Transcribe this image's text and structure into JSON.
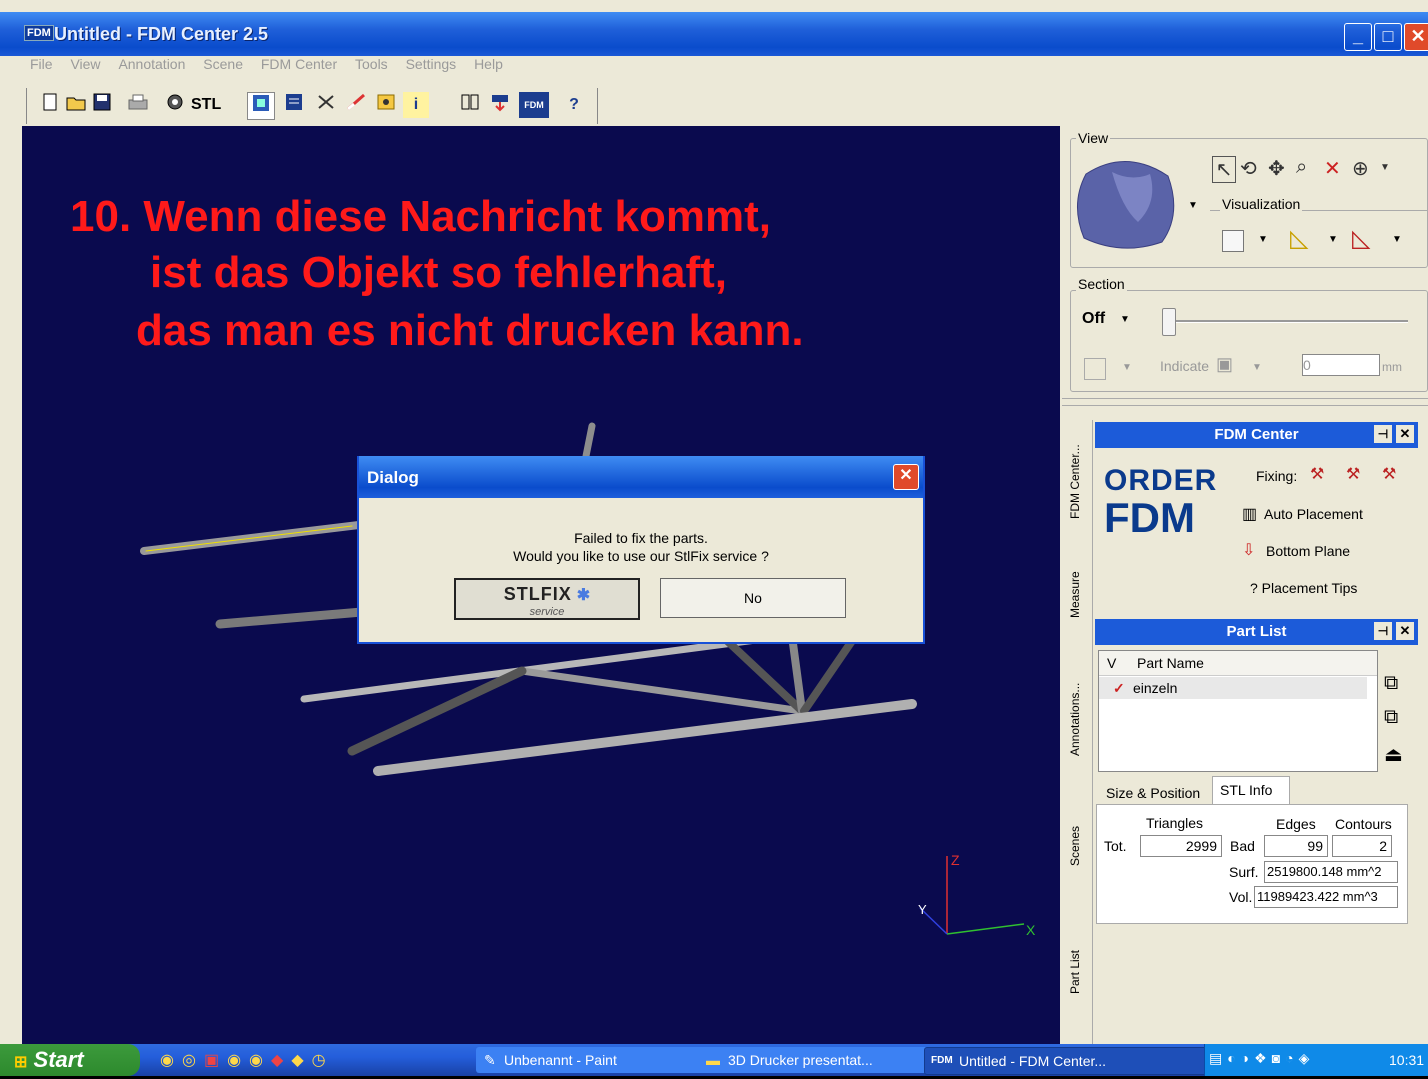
{
  "window": {
    "app_icon": "FDM",
    "title": "Untitled - FDM Center 2.5",
    "controls": [
      "_",
      "□",
      "✕"
    ]
  },
  "menu": [
    "File",
    "View",
    "Annotation",
    "Scene",
    "FDM Center",
    "Tools",
    "Settings",
    "Help"
  ],
  "toolbar": {
    "stl_label": "STL",
    "info_label": "i",
    "fdm_label": "FDM",
    "help_label": "?"
  },
  "viewport": {
    "headline": [
      "10. Wenn diese Nachricht kommt,",
      "ist das Objekt so fehlerhaft,",
      "das man es nicht drucken kann."
    ],
    "axes": {
      "z": "Z",
      "x": "X",
      "y": "Y"
    }
  },
  "dialog": {
    "title": "Dialog",
    "close": "✕",
    "message_line1": "Failed to fix the parts.",
    "message_line2": "Would you like to use our StlFix service ?",
    "stlfix_label": "STLFIX",
    "stlfix_sub": "service",
    "no_label": "No"
  },
  "view_panel": {
    "label": "View",
    "visualization_label": "Visualization"
  },
  "section_panel": {
    "label": "Section",
    "mode": "Off",
    "indicate_label": "Indicate",
    "value": "0",
    "unit": "mm"
  },
  "side_tabs": [
    "FDM Center...",
    "Measure",
    "Annotations...",
    "Scenes",
    "Part List"
  ],
  "fdm_center": {
    "title": "FDM Center",
    "order_line1": "ORDER",
    "order_line2": "FDM",
    "fixing_label": "Fixing:",
    "auto_placement": "Auto Placement",
    "bottom_plane": "Bottom Plane",
    "placement_tips": "? Placement Tips"
  },
  "part_list": {
    "title": "Part List",
    "columns": [
      "V",
      "Part Name"
    ],
    "rows": [
      {
        "checked": "✓",
        "name": "einzeln"
      }
    ],
    "tabs": [
      "Size & Position",
      "STL Info"
    ],
    "stl_info": {
      "triangles_label": "Triangles",
      "tot_label": "Tot.",
      "triangles_value": "2999",
      "edges_label": "Edges",
      "contours_label": "Contours",
      "bad_label": "Bad",
      "edges_value": "99",
      "contours_value": "2",
      "surf_label": "Surf.",
      "surf_value": "2519800.148 mm^2",
      "vol_label": "Vol.",
      "vol_value": "11989423.422 mm^3"
    }
  },
  "taskbar": {
    "start_label": "Start",
    "tasks": [
      "Unbenannt - Paint",
      "3D Drucker presentat...",
      "Untitled - FDM Center..."
    ],
    "clock": "10:31"
  },
  "colors": {
    "viewport_bg": "#0a0a4e",
    "headline": "#ff1a1a",
    "xp_blue": "#0a4ccc",
    "order_blue": "#0a3a8c"
  }
}
